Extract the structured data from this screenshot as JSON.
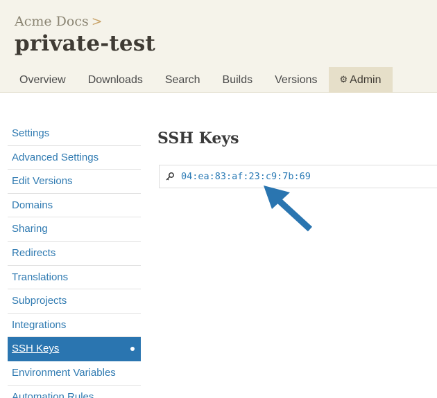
{
  "header": {
    "breadcrumb": "Acme Docs",
    "breadcrumb_separator": ">",
    "project_title": "private-test"
  },
  "tabs": [
    {
      "label": "Overview",
      "active": false
    },
    {
      "label": "Downloads",
      "active": false
    },
    {
      "label": "Search",
      "active": false
    },
    {
      "label": "Builds",
      "active": false
    },
    {
      "label": "Versions",
      "active": false
    },
    {
      "label": "Admin",
      "active": true,
      "icon": "gear-icon"
    }
  ],
  "sidebar": {
    "items": [
      {
        "label": "Settings"
      },
      {
        "label": "Advanced Settings"
      },
      {
        "label": "Edit Versions"
      },
      {
        "label": "Domains"
      },
      {
        "label": "Sharing"
      },
      {
        "label": "Redirects"
      },
      {
        "label": "Translations"
      },
      {
        "label": "Subprojects"
      },
      {
        "label": "Integrations"
      },
      {
        "label": "SSH Keys",
        "active": true
      },
      {
        "label": "Environment Variables"
      },
      {
        "label": "Automation Rules"
      }
    ]
  },
  "main": {
    "title": "SSH Keys",
    "keys": [
      {
        "fingerprint": "04:ea:83:af:23:c9:7b:69",
        "icon": "key-icon"
      }
    ]
  },
  "annotation": {
    "icon": "arrow-icon",
    "color": "#2a75b0"
  },
  "colors": {
    "header_bg": "#f5f3ea",
    "active_tab_bg": "#e6dfc9",
    "link": "#2f7ab1",
    "active_sidebar_bg": "#2a75b0"
  }
}
